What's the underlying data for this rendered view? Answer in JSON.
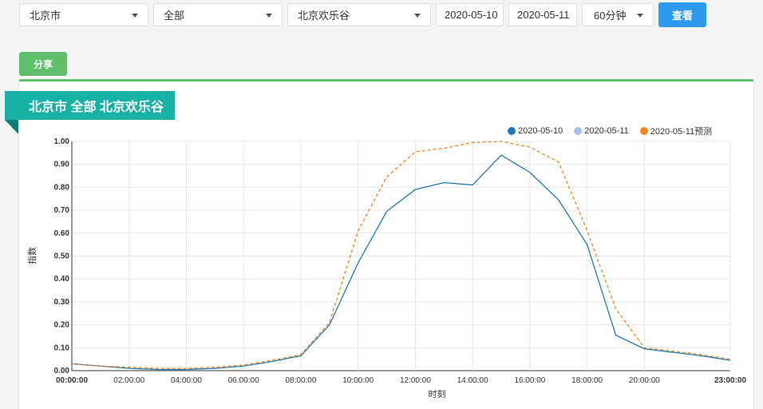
{
  "filters": {
    "city": "北京市",
    "category": "全部",
    "place": "北京欢乐谷",
    "start_date": "2020-05-10",
    "end_date": "2020-05-11",
    "interval": "60分钟",
    "search_label": "查看"
  },
  "share_label": "分享",
  "panel_title": "北京市  全部  北京欢乐谷",
  "colors": {
    "primary": "#2d9af0",
    "green": "#5fbf6b",
    "teal": "#17b2a5",
    "series_1": "#1f78b4",
    "series_2": "#a6c3e6",
    "series_3": "#f5831f"
  },
  "chart_data": {
    "type": "line",
    "xlabel": "时刻",
    "ylabel": "指数",
    "ylim": [
      0,
      1
    ],
    "y_ticks": [
      "0.00",
      "0.10",
      "0.20",
      "0.30",
      "0.40",
      "0.50",
      "0.60",
      "0.70",
      "0.80",
      "0.90",
      "1.00"
    ],
    "x_ticks": [
      "00:00:00",
      "02:00:00",
      "04:00:00",
      "06:00:00",
      "08:00:00",
      "10:00:00",
      "12:00:00",
      "14:00:00",
      "16:00:00",
      "18:00:00",
      "20:00:00",
      "23:00:00"
    ],
    "x_hours": [
      0,
      1,
      2,
      3,
      4,
      5,
      6,
      7,
      8,
      9,
      10,
      11,
      12,
      13,
      14,
      15,
      16,
      17,
      18,
      19,
      20,
      21,
      22,
      23
    ],
    "legend_position": "top-right",
    "grid": true,
    "series": [
      {
        "name": "2020-05-10",
        "style": "solid",
        "values": [
          0.03,
          0.02,
          0.01,
          0.005,
          0.005,
          0.01,
          0.02,
          0.04,
          0.065,
          0.2,
          0.47,
          0.695,
          0.79,
          0.82,
          0.81,
          0.94,
          0.865,
          0.745,
          0.55,
          0.155,
          0.095,
          0.08,
          0.065,
          0.045
        ]
      },
      {
        "name": "2020-05-11",
        "style": "solid",
        "values": []
      },
      {
        "name": "2020-05-11预测",
        "style": "dashed",
        "values": [
          0.03,
          0.02,
          0.015,
          0.01,
          0.01,
          0.015,
          0.025,
          0.045,
          0.07,
          0.21,
          0.61,
          0.845,
          0.955,
          0.97,
          0.995,
          1.0,
          0.975,
          0.91,
          0.61,
          0.27,
          0.1,
          0.085,
          0.07,
          0.05
        ]
      }
    ]
  }
}
